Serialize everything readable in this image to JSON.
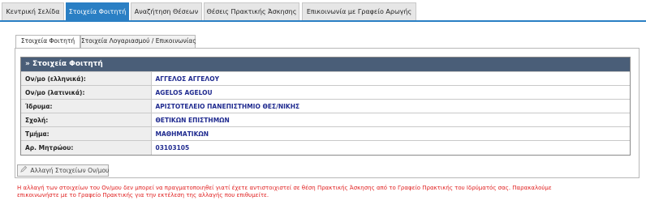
{
  "nav": {
    "tabs": [
      {
        "label": "Κεντρική Σελίδα"
      },
      {
        "label": "Στοιχεία Φοιτητή"
      },
      {
        "label": "Αναζήτηση Θέσεων"
      },
      {
        "label": "Θέσεις Πρακτικής Άσκησης"
      },
      {
        "label": "Επικοινωνία με Γραφείο Αρωγής"
      }
    ],
    "active_index": 1
  },
  "subtabs": [
    {
      "label": "Στοιχεία Φοιτητή"
    },
    {
      "label": "Στοιχεία Λογαριασμού / Επικοινωνίας"
    }
  ],
  "student_box": {
    "title": "» Στοιχεία Φοιτητή",
    "rows": [
      {
        "label": "Ον/μο (ελληνικά):",
        "value": "ΑΓΓΕΛΟΣ ΑΓΓΕΛΟΥ"
      },
      {
        "label": "Ον/μο (λατινικά):",
        "value": "AGELOS AGELOU"
      },
      {
        "label": "Ίδρυμα:",
        "value": "ΑΡΙΣΤΟΤΕΛΕΙΟ ΠΑΝΕΠΙΣΤΗΜΙΟ ΘΕΣ/ΝΙΚΗΣ"
      },
      {
        "label": "Σχολή:",
        "value": "ΘΕΤΙΚΩΝ ΕΠΙΣΤΗΜΩΝ"
      },
      {
        "label": "Τμήμα:",
        "value": "ΜΑΘΗΜΑΤΙΚΩΝ"
      },
      {
        "label": "Αρ. Μητρώου:",
        "value": "03103105"
      }
    ]
  },
  "change_button": {
    "label": "Αλλαγή Στοιχείων Ον/μου",
    "icon": "edit-icon"
  },
  "warning": {
    "line1": "Η αλλαγή των στοιχείων του Ον/μου δεν μπορεί να πραγματοποιηθεί γιατί έχετε αντιστοιχιστεί σε θέση Πρακτικής Άσκησης από το Γραφείο Πρακτικής του Ιδρύματός σας. Παρακαλούμε",
    "line2": "επικοινωνήστε με το Γραφείο Πρακτικής για την εκτέλεση της αλλαγής που επιθυμείτε."
  },
  "colors": {
    "accent": "#2a7fc4",
    "header_bar": "#4a5e78",
    "value_text": "#1f2a8f",
    "warning_text": "#e02020"
  }
}
